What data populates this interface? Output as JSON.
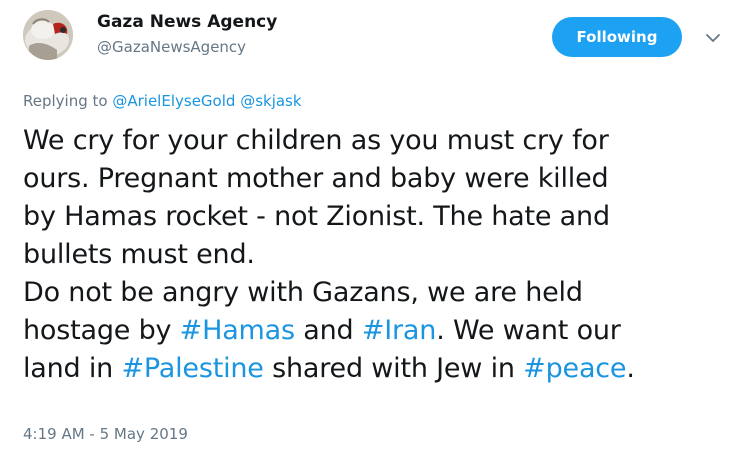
{
  "user": {
    "display_name": "Gaza News Agency",
    "handle": "@GazaNewsAgency"
  },
  "follow_button": {
    "label": "Following"
  },
  "reply": {
    "prefix": "Replying to",
    "mentions": [
      "@ArielElyseGold",
      "@skjask"
    ]
  },
  "tweet": {
    "lines": [
      [
        {
          "text": "We cry for your children as you must cry for"
        }
      ],
      [
        {
          "text": "ours. Pregnant mother and baby were killed"
        }
      ],
      [
        {
          "text": "by Hamas rocket - not Zionist. The hate and"
        }
      ],
      [
        {
          "text": "bullets must end."
        }
      ],
      [
        {
          "text": "Do not be angry with Gazans, we are held"
        }
      ],
      [
        {
          "text": "hostage by "
        },
        {
          "text": "#Hamas",
          "link": true
        },
        {
          "text": " and "
        },
        {
          "text": "#Iran",
          "link": true
        },
        {
          "text": ". We want our"
        }
      ],
      [
        {
          "text": "land in "
        },
        {
          "text": "#Palestine",
          "link": true
        },
        {
          "text": " shared with Jew in "
        },
        {
          "text": "#peace",
          "link": true
        },
        {
          "text": "."
        }
      ]
    ]
  },
  "timestamp": "4:19 AM - 5 May 2019",
  "icons": {
    "avatar": "profile-avatar-image",
    "caret": "chevron-down-icon"
  },
  "colors": {
    "accent": "#1da1f2",
    "link": "#1b95e0",
    "secondary_text": "#657786",
    "primary_text": "#14171a"
  }
}
